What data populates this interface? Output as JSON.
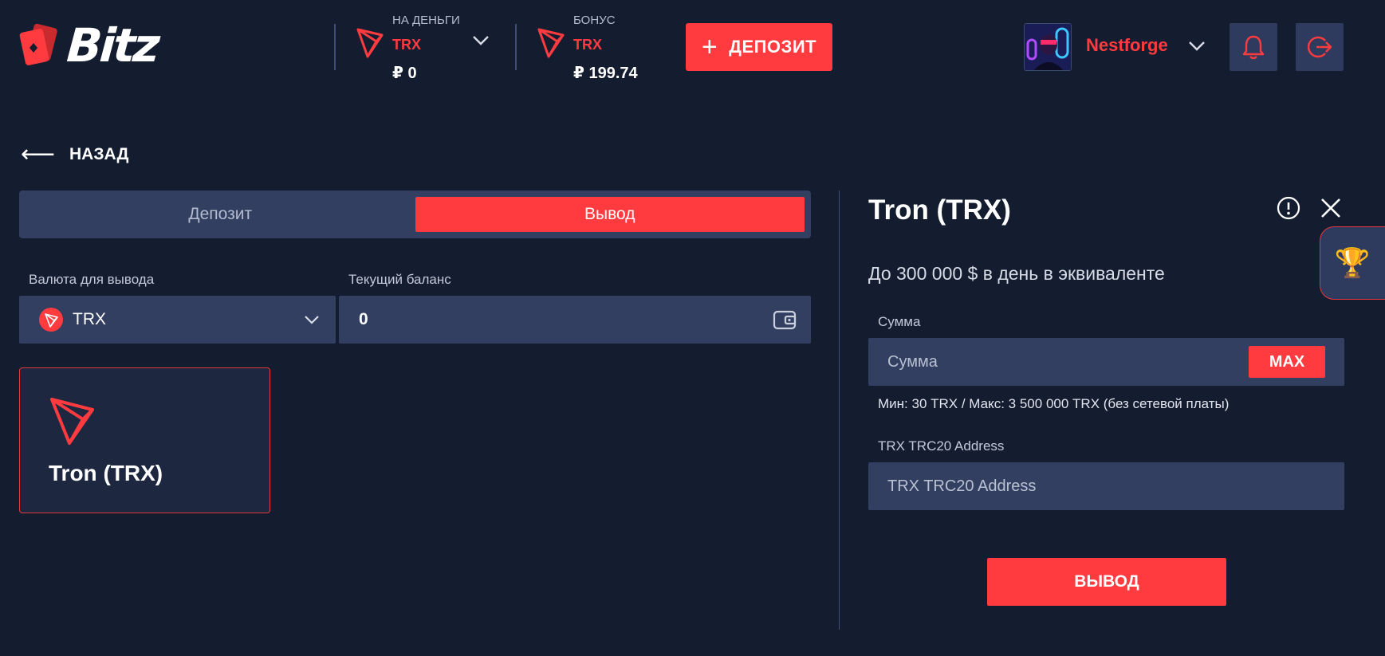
{
  "header": {
    "logo_text": "Bitz",
    "main_balance": {
      "label": "НА ДЕНЬГИ",
      "currency": "TRX",
      "amount": "₽ 0"
    },
    "bonus_balance": {
      "label": "БОНУС",
      "currency": "TRX",
      "amount": "₽ 199.74"
    },
    "deposit_label": "ДЕПОЗИТ",
    "username": "Nestforge"
  },
  "back_label": "НАЗАД",
  "tabs": [
    {
      "label": "Депозит",
      "active": false
    },
    {
      "label": "Вывод",
      "active": true
    }
  ],
  "form": {
    "currency_label": "Валюта для вывода",
    "currency_value": "TRX",
    "balance_label": "Текущий баланс",
    "balance_value": "0"
  },
  "method_card": {
    "title": "Tron (TRX)"
  },
  "panel": {
    "title": "Tron (TRX)",
    "subtitle": "До 300 000 $ в день в эквиваленте",
    "amount_label": "Сумма",
    "amount_placeholder": "Сумма",
    "max_label": "MAX",
    "limits": "Мин: 30 TRX / Макс: 3 500 000 TRX (без сетевой платы)",
    "address_label": "TRX TRC20 Address",
    "address_placeholder": "TRX TRC20 Address",
    "submit_label": "ВЫВОД"
  },
  "colors": {
    "background": "#141d30",
    "panel": "#323f61",
    "accent": "#ff3b3f",
    "muted_text": "#b6bdd0"
  }
}
